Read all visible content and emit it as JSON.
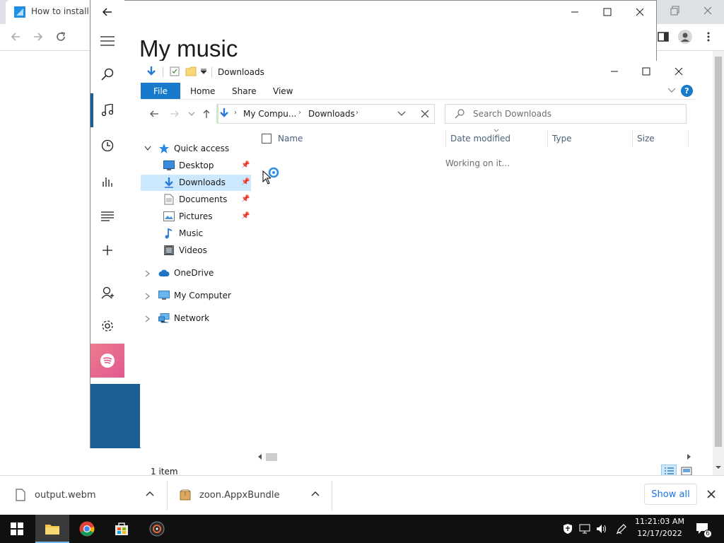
{
  "browser": {
    "tab_title": "How to install A"
  },
  "music_app": {
    "title": "My music"
  },
  "explorer": {
    "window_title": "Downloads",
    "ribbon": {
      "file": "File",
      "home": "Home",
      "share": "Share",
      "view": "View",
      "help": "?"
    },
    "address": {
      "crumb1": "My Compu...",
      "crumb2": "Downloads"
    },
    "search_placeholder": "Search Downloads",
    "columns": {
      "name": "Name",
      "date": "Date modified",
      "type": "Type",
      "size": "Size"
    },
    "working_text": "Working on it...",
    "tree": {
      "quick_access": "Quick access",
      "desktop": "Desktop",
      "downloads": "Downloads",
      "documents": "Documents",
      "pictures": "Pictures",
      "music": "Music",
      "videos": "Videos",
      "onedrive": "OneDrive",
      "my_computer": "My Computer",
      "network": "Network"
    },
    "status": "1 item"
  },
  "shelf": {
    "item1": "output.webm",
    "item2": "zoon.AppxBundle",
    "show_all": "Show all"
  },
  "taskbar": {
    "time": "11:21:03 AM",
    "date": "12/17/2022",
    "notification_count": "6"
  },
  "colors": {
    "accent": "#1979ca",
    "music_accent": "#1a5e93",
    "selected": "#cce8ff"
  }
}
